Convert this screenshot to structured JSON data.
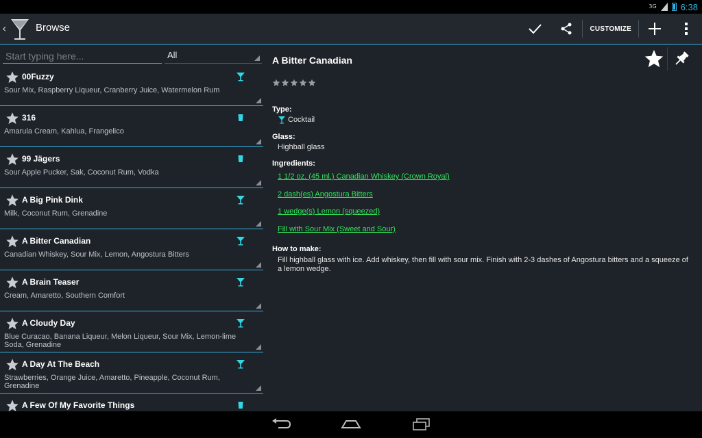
{
  "status": {
    "network": "3G",
    "time": "6:38"
  },
  "actionbar": {
    "title": "Browse",
    "customize_label": "CUSTOMIZE",
    "icons": [
      "back-chevron-icon",
      "cocktail-logo-icon",
      "check-icon",
      "share-icon",
      "add-icon",
      "overflow-menu-icon"
    ]
  },
  "filter": {
    "search_placeholder": "Start typing here...",
    "search_value": "",
    "category": "All"
  },
  "drinks": [
    {
      "name": "00Fuzzy",
      "ingredients": "Sour Mix, Raspberry Liqueur, Cranberry Juice, Watermelon Rum",
      "glass": "cocktail"
    },
    {
      "name": "316",
      "ingredients": "Amarula Cream, Kahlua, Frangelico",
      "glass": "shot"
    },
    {
      "name": "99 Jägers",
      "ingredients": "Sour Apple Pucker, Sak, Coconut Rum, Vodka",
      "glass": "shot"
    },
    {
      "name": "A Big Pink Dink",
      "ingredients": "Milk, Coconut Rum, Grenadine",
      "glass": "cocktail"
    },
    {
      "name": "A Bitter Canadian",
      "ingredients": "Canadian Whiskey, Sour Mix, Lemon, Angostura Bitters",
      "glass": "cocktail"
    },
    {
      "name": "A Brain Teaser",
      "ingredients": "Cream, Amaretto, Southern Comfort",
      "glass": "cocktail"
    },
    {
      "name": "A Cloudy Day",
      "ingredients": "Blue Curacao, Banana Liqueur, Melon Liqueur, Sour Mix, Lemon-lime Soda, Grenadine",
      "glass": "cocktail"
    },
    {
      "name": "A Day At The Beach",
      "ingredients": "Strawberries, Orange Juice, Amaretto, Pineapple, Coconut Rum, Grenadine",
      "glass": "cocktail"
    },
    {
      "name": "A Few Of My Favorite Things",
      "ingredients": "",
      "glass": "shot"
    }
  ],
  "detail": {
    "title": "A Bitter Canadian",
    "rating": 0,
    "rating_max": 5,
    "type_label": "Type:",
    "type_value": "Cocktail",
    "glass_label": "Glass:",
    "glass_value": "Highball glass",
    "ingredients_label": "Ingredients:",
    "ingredients": [
      "1 1/2 oz. (45 ml.) Canadian Whiskey (Crown Royal)",
      "2 dash(es) Angostura Bitters",
      "1 wedge(s) Lemon (squeezed)",
      "Fill with Sour Mix (Sweet and Sour)"
    ],
    "howto_label": "How to make:",
    "howto": "Fill highball glass with ice. Add whiskey, then fill with sour mix. Finish with 2-3 dashes of Angostura bitters and a squeeze of a lemon wedge."
  },
  "colors": {
    "accent": "#33b5e5",
    "link": "#33e55a",
    "background": "#1e2329",
    "glass_icon": "#33d6e5"
  }
}
